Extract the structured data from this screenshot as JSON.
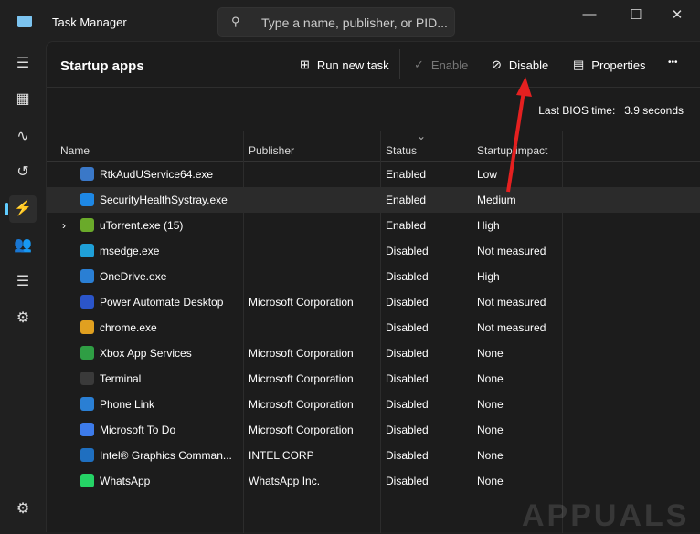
{
  "window": {
    "title": "Task Manager",
    "search_placeholder": "Type a name, publisher, or PID...",
    "minimize": "—",
    "maximize": "☐",
    "close": "✕"
  },
  "sidebar": {
    "items": [
      {
        "name": "hamburger",
        "glyph": "☰"
      },
      {
        "name": "processes",
        "glyph": "▦"
      },
      {
        "name": "performance",
        "glyph": "∿"
      },
      {
        "name": "app-history",
        "glyph": "↺"
      },
      {
        "name": "startup-apps",
        "glyph": "⚡"
      },
      {
        "name": "users",
        "glyph": "👥"
      },
      {
        "name": "details",
        "glyph": "☰"
      },
      {
        "name": "services",
        "glyph": "⚙"
      }
    ],
    "settings": "⚙"
  },
  "header": {
    "title": "Startup apps",
    "run_new_task": "Run new task",
    "enable": "Enable",
    "disable": "Disable",
    "properties": "Properties",
    "more": "•••"
  },
  "bios": {
    "label": "Last BIOS time:",
    "value": "3.9 seconds"
  },
  "columns": {
    "name": "Name",
    "publisher": "Publisher",
    "status": "Status",
    "impact": "Startup impact",
    "sort": "⌄"
  },
  "rows": [
    {
      "name": "RtkAudUService64.exe",
      "publisher": "",
      "status": "Enabled",
      "impact": "Low",
      "color": "#3a78c8"
    },
    {
      "name": "SecurityHealthSystray.exe",
      "publisher": "",
      "status": "Enabled",
      "impact": "Medium",
      "color": "#1e88e5"
    },
    {
      "name": "uTorrent.exe (15)",
      "publisher": "",
      "status": "Enabled",
      "impact": "High",
      "color": "#6aaa2a",
      "expand": "›"
    },
    {
      "name": "msedge.exe",
      "publisher": "",
      "status": "Disabled",
      "impact": "Not measured",
      "color": "#1fa0d8"
    },
    {
      "name": "OneDrive.exe",
      "publisher": "",
      "status": "Disabled",
      "impact": "High",
      "color": "#2a7fd4"
    },
    {
      "name": "Power Automate Desktop",
      "publisher": "Microsoft Corporation",
      "status": "Disabled",
      "impact": "Not measured",
      "color": "#2b55c9"
    },
    {
      "name": "chrome.exe",
      "publisher": "",
      "status": "Disabled",
      "impact": "Not measured",
      "color": "#e0a020"
    },
    {
      "name": "Xbox App Services",
      "publisher": "Microsoft Corporation",
      "status": "Disabled",
      "impact": "None",
      "color": "#2f9e44"
    },
    {
      "name": "Terminal",
      "publisher": "Microsoft Corporation",
      "status": "Disabled",
      "impact": "None",
      "color": "#3a3a3a"
    },
    {
      "name": "Phone Link",
      "publisher": "Microsoft Corporation",
      "status": "Disabled",
      "impact": "None",
      "color": "#2a7fd4"
    },
    {
      "name": "Microsoft To Do",
      "publisher": "Microsoft Corporation",
      "status": "Disabled",
      "impact": "None",
      "color": "#3d7bea"
    },
    {
      "name": "Intel® Graphics Comman...",
      "publisher": "INTEL CORP",
      "status": "Disabled",
      "impact": "None",
      "color": "#1f6fc0"
    },
    {
      "name": "WhatsApp",
      "publisher": "WhatsApp Inc.",
      "status": "Disabled",
      "impact": "None",
      "color": "#25d366"
    }
  ],
  "watermark": "APPUALS"
}
